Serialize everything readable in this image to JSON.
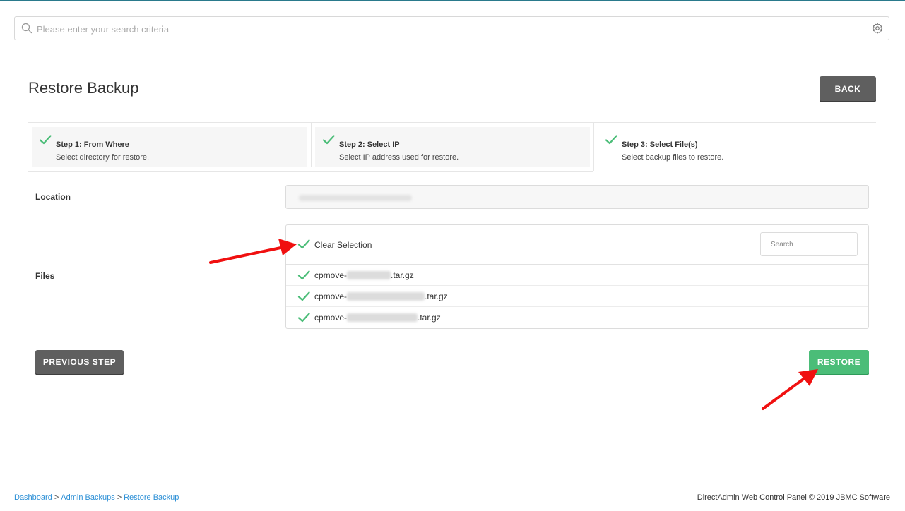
{
  "search": {
    "placeholder": "Please enter your search criteria"
  },
  "header": {
    "title": "Restore Backup",
    "back_label": "BACK"
  },
  "steps": [
    {
      "title": "Step 1: From Where",
      "desc": "Select directory for restore.",
      "done": true
    },
    {
      "title": "Step 2: Select IP",
      "desc": "Select IP address used for restore.",
      "done": true
    },
    {
      "title": "Step 3: Select File(s)",
      "desc": "Select backup files to restore.",
      "done": false
    }
  ],
  "location": {
    "label": "Location"
  },
  "files": {
    "label": "Files",
    "clear_label": "Clear Selection",
    "search_placeholder": "Search",
    "items": [
      {
        "prefix": "cpmove-",
        "suffix": ".tar.gz",
        "checked": true
      },
      {
        "prefix": "cpmove-",
        "suffix": ".tar.gz",
        "checked": true
      },
      {
        "prefix": "cpmove-",
        "suffix": ".tar.gz",
        "checked": true
      }
    ]
  },
  "actions": {
    "prev_label": "PREVIOUS STEP",
    "restore_label": "RESTORE"
  },
  "breadcrumb": [
    "Dashboard",
    "Admin Backups",
    "Restore Backup"
  ],
  "footer": {
    "copyright": "DirectAdmin Web Control Panel © 2019 JBMC Software"
  },
  "colors": {
    "check": "#4bbd78",
    "restore": "#4bbd78",
    "dark_button": "#5f5f5f",
    "link": "#2b8fd6",
    "arrow": "#f01010"
  },
  "icons": {
    "search": "search-icon",
    "settings": "gear-icon",
    "check": "check-icon",
    "annotation": "red-arrow-icon"
  }
}
